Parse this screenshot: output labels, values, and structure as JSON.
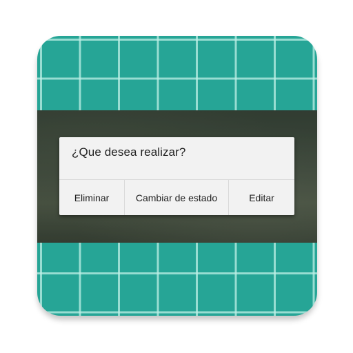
{
  "dialog": {
    "title": "¿Que desea realizar?",
    "buttons": {
      "delete_label": "Eliminar",
      "change_state_label": "Cambiar de estado",
      "edit_label": "Editar"
    }
  },
  "colors": {
    "icon_background": "#26a596",
    "grid_lines": "#bef0e6",
    "dialog_background": "#f2f2f2",
    "text": "#212121"
  }
}
